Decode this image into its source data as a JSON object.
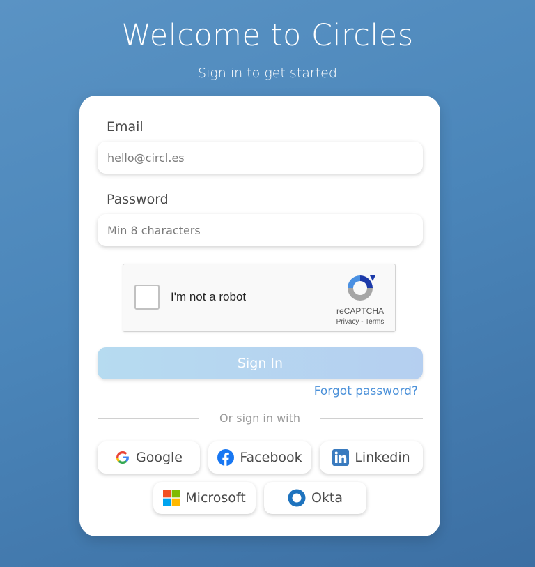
{
  "header": {
    "title": "Welcome to Circles",
    "subtitle": "Sign in to get started"
  },
  "form": {
    "email_label": "Email",
    "email_placeholder": "hello@circl.es",
    "password_label": "Password",
    "password_placeholder": "Min 8 characters",
    "captcha_text": "I'm not a robot",
    "captcha_brand": "reCAPTCHA",
    "captcha_links": "Privacy - Terms",
    "signin_label": "Sign In",
    "forgot_label": "Forgot password?",
    "divider_text": "Or sign in with"
  },
  "social": {
    "google": "Google",
    "facebook": "Facebook",
    "linkedin": "Linkedin",
    "microsoft": "Microsoft",
    "okta": "Okta"
  },
  "colors": {
    "background": "#4b86ba",
    "signin_button": "#b6dbf0",
    "link": "#4a90d9",
    "facebook": "#1877f2",
    "linkedin": "#0a66c2",
    "okta": "#1e73be"
  }
}
